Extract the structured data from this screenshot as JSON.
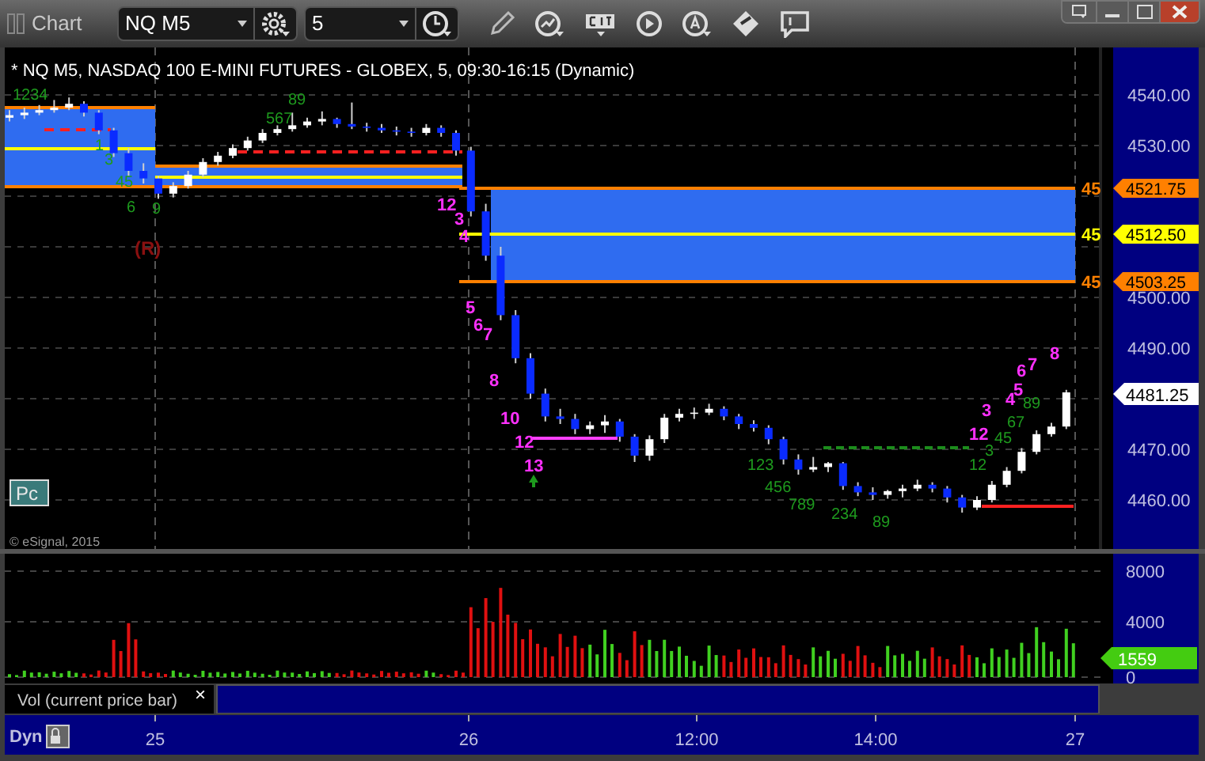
{
  "window": {
    "title": "Chart"
  },
  "toolbar": {
    "symbol": "NQ M5",
    "interval": "5"
  },
  "chart": {
    "header": "* NQ M5, NASDAQ 100 E-MINI FUTURES - GLOBEX, 5, 09:30-16:15 (Dynamic)",
    "levels": [
      {
        "label": "45",
        "marker": "4521.75",
        "kind": "band"
      },
      {
        "label": "45",
        "marker": "4512.50",
        "kind": "mid"
      },
      {
        "label": "45",
        "marker": "4503.25",
        "kind": "band"
      }
    ],
    "last_price": "4481.25",
    "chart_data": {
      "type": "candlestick",
      "ylim": [
        4450,
        4549.375
      ],
      "yticks": [
        {
          "value": 4540,
          "label": "4540.00"
        },
        {
          "value": 4530,
          "label": "4530.00"
        },
        {
          "value": 4500,
          "label": "4500.00"
        },
        {
          "value": 4490,
          "label": "4490.00"
        },
        {
          "value": 4470,
          "label": "4470.00"
        },
        {
          "value": 4460,
          "label": "4460.00"
        }
      ],
      "categories": [
        null,
        null,
        null,
        null,
        null,
        null,
        null,
        null,
        null,
        null,
        null,
        null,
        null,
        null,
        null,
        null,
        null,
        null,
        null,
        null,
        null,
        null,
        null,
        null,
        null,
        null,
        null,
        null,
        null,
        null,
        null,
        null,
        null,
        null,
        null,
        null,
        null,
        null,
        null,
        null,
        null,
        null,
        null,
        null,
        null,
        null,
        null,
        null,
        null,
        null,
        null,
        null,
        null,
        null,
        null,
        null,
        null,
        null,
        null,
        null,
        null,
        null,
        null,
        null,
        null,
        null,
        null,
        null,
        null,
        null,
        null,
        null
      ],
      "ohlc": [
        [
          4535.5,
          4537,
          4534.75,
          4536
        ],
        [
          4536,
          4537.5,
          4535.25,
          4536.5
        ],
        [
          4536.5,
          4538,
          4536,
          4537
        ],
        [
          4537,
          4539,
          4536.5,
          4537.5
        ],
        [
          4537.5,
          4539.5,
          4537,
          4538.25
        ],
        [
          4538.25,
          4538.75,
          4535.75,
          4536.5
        ],
        [
          4536.5,
          4537,
          4532.25,
          4533
        ],
        [
          4533,
          4533.5,
          4527.75,
          4528.5
        ],
        [
          4528.5,
          4529.5,
          4524,
          4525
        ],
        [
          4525,
          4526.5,
          4522.5,
          4523.5
        ],
        [
          4523.5,
          4524,
          4519.5,
          4520.5
        ],
        [
          4520.5,
          4522.75,
          4519.75,
          4522
        ],
        [
          4522,
          4525,
          4521.5,
          4524.25
        ],
        [
          4524.25,
          4527.5,
          4523.75,
          4526.75
        ],
        [
          4526.75,
          4528.75,
          4526,
          4528
        ],
        [
          4528,
          4530.25,
          4527.5,
          4529.5
        ],
        [
          4529.5,
          4531.75,
          4529,
          4531
        ],
        [
          4531,
          4533.25,
          4530.5,
          4532.5
        ],
        [
          4532.5,
          4534,
          4532,
          4533.25
        ],
        [
          4533.25,
          4536.5,
          4532.75,
          4534
        ],
        [
          4534,
          4535.5,
          4533.5,
          4534.75
        ],
        [
          4534.75,
          4536.75,
          4534,
          4535.25
        ],
        [
          4535.25,
          4535.5,
          4533.5,
          4534.25
        ],
        [
          4534.25,
          4538.5,
          4533.25,
          4533.75
        ],
        [
          4533.75,
          4534.5,
          4532.75,
          4533.5
        ],
        [
          4533.5,
          4534.25,
          4532.5,
          4533
        ],
        [
          4533,
          4533.75,
          4532,
          4532.75
        ],
        [
          4532.75,
          4533.5,
          4531.75,
          4532.5
        ],
        [
          4532.5,
          4534.25,
          4532,
          4533.5
        ],
        [
          4533.5,
          4534,
          4531.75,
          4532.5
        ],
        [
          4532.5,
          4533,
          4528,
          4529
        ],
        [
          4529,
          4529.75,
          4516,
          4517
        ],
        [
          4517,
          4518.5,
          4507.25,
          4508.25
        ],
        [
          4508.25,
          4510,
          4495.5,
          4496.5
        ],
        [
          4496.5,
          4497.5,
          4487,
          4488
        ],
        [
          4488,
          4489,
          4480,
          4481
        ],
        [
          4481,
          4482,
          4475.5,
          4476.5
        ],
        [
          4476.5,
          4478,
          4475,
          4476
        ],
        [
          4476,
          4477,
          4473,
          4474
        ],
        [
          4474,
          4475.5,
          4473,
          4474.75
        ],
        [
          4474.75,
          4476.75,
          4473.25,
          4475.5
        ],
        [
          4475.5,
          4476,
          4471.5,
          4472.5
        ],
        [
          4472.5,
          4473,
          4467.5,
          4468.75
        ],
        [
          4468.75,
          4472.75,
          4467.75,
          4472
        ],
        [
          4472,
          4477,
          4471.25,
          4476.25
        ],
        [
          4476.25,
          4478,
          4475.5,
          4477
        ],
        [
          4477,
          4478.25,
          4476,
          4477.25
        ],
        [
          4477.25,
          4479,
          4476.75,
          4478
        ],
        [
          4478,
          4478.5,
          4475.75,
          4476.5
        ],
        [
          4476.5,
          4477,
          4474,
          4475
        ],
        [
          4475,
          4475.75,
          4473.5,
          4474.25
        ],
        [
          4474.25,
          4474.75,
          4471,
          4472
        ],
        [
          4472,
          4472.5,
          4467,
          4468
        ],
        [
          4468,
          4469,
          4465,
          4466
        ],
        [
          4466,
          4468.5,
          4465.5,
          4466.5
        ],
        [
          4466.5,
          4467.5,
          4465.5,
          4467.25
        ],
        [
          4467.25,
          4467.5,
          4462,
          4462.75
        ],
        [
          4462.75,
          4463.5,
          4460.75,
          4461.5
        ],
        [
          4461.5,
          4462.5,
          4460,
          4461
        ],
        [
          4461,
          4462,
          4460.25,
          4461.75
        ],
        [
          4461.75,
          4463,
          4460.5,
          4462.25
        ],
        [
          4462.25,
          4464,
          4461.75,
          4463
        ],
        [
          4463,
          4463.5,
          4461.5,
          4462.25
        ],
        [
          4462.25,
          4462.75,
          4459.5,
          4460.5
        ],
        [
          4460.5,
          4461,
          4457.5,
          4458.5
        ],
        [
          4458.5,
          4460.75,
          4458,
          4460
        ],
        [
          4460,
          4463.75,
          4459.5,
          4463
        ],
        [
          4463,
          4466.5,
          4462.5,
          4465.75
        ],
        [
          4465.75,
          4470.25,
          4465.25,
          4469.5
        ],
        [
          4469.5,
          4473.75,
          4469,
          4473
        ],
        [
          4473,
          4475.25,
          4472.5,
          4474.5
        ],
        [
          4474.5,
          4481.75,
          4474,
          4481.25
        ]
      ]
    },
    "counts": [
      {
        "text": "12",
        "kind": "setup"
      },
      {
        "text": "3",
        "kind": "setup"
      },
      {
        "text": "4",
        "kind": "setup"
      },
      {
        "text": "5",
        "kind": "setup"
      },
      {
        "text": "6",
        "kind": "setup"
      },
      {
        "text": "7",
        "kind": "setup"
      },
      {
        "text": "8",
        "kind": "setup"
      },
      {
        "text": "10",
        "kind": "setup"
      },
      {
        "text": "12",
        "kind": "setup"
      },
      {
        "text": "13",
        "kind": "setup"
      },
      {
        "text": "8",
        "kind": "setup"
      },
      {
        "text": "7",
        "kind": "setup"
      },
      {
        "text": "6",
        "kind": "setup"
      },
      {
        "text": "5",
        "kind": "setup"
      },
      {
        "text": "4",
        "kind": "setup"
      },
      {
        "text": "3",
        "kind": "setup"
      },
      {
        "text": "12",
        "kind": "setup"
      },
      {
        "text": "1234",
        "kind": "countdown"
      },
      {
        "text": "567",
        "kind": "countdown"
      },
      {
        "text": "89",
        "kind": "countdown"
      },
      {
        "text": "1",
        "kind": "countdown"
      },
      {
        "text": "3",
        "kind": "countdown"
      },
      {
        "text": "45",
        "kind": "countdown"
      },
      {
        "text": "6",
        "kind": "countdown"
      },
      {
        "text": "9",
        "kind": "countdown"
      },
      {
        "text": "123",
        "kind": "countdown"
      },
      {
        "text": "456",
        "kind": "countdown"
      },
      {
        "text": "789",
        "kind": "countdown"
      },
      {
        "text": "234",
        "kind": "countdown"
      },
      {
        "text": "89",
        "kind": "countdown"
      },
      {
        "text": "12",
        "kind": "countdown"
      },
      {
        "text": "3",
        "kind": "countdown"
      },
      {
        "text": "45",
        "kind": "countdown"
      },
      {
        "text": "67",
        "kind": "countdown"
      },
      {
        "text": "89",
        "kind": "countdown"
      }
    ],
    "study_mark": "(R)",
    "pc_button": "Pc",
    "copyright": "© eSignal, 2015"
  },
  "volume": {
    "axis": [
      "8000",
      "4000",
      "0"
    ],
    "reading": "1559",
    "label": "Vol (current price bar)",
    "close": "×"
  },
  "bottom_bar": {
    "mode": "Dyn",
    "dates": [
      "25",
      "26",
      "12:00",
      "14:00",
      "27"
    ]
  }
}
